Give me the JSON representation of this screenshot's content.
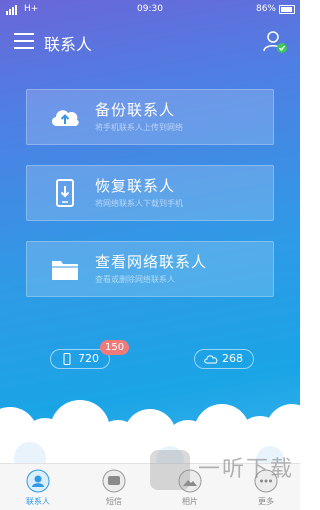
{
  "status_bar": {
    "network": "H+",
    "time": "09:30",
    "battery": "86%"
  },
  "header": {
    "title": "联系人",
    "menu_icon": "menu-icon",
    "user_icon": "user-check-icon"
  },
  "actions": [
    {
      "title": "备份联系人",
      "subtitle": "将手机联系人上传到网络",
      "icon": "cloud-upload-icon"
    },
    {
      "title": "恢复联系人",
      "subtitle": "将网络联系人下载到手机",
      "icon": "phone-download-icon"
    },
    {
      "title": "查看网络联系人",
      "subtitle": "查看或删除网络联系人",
      "icon": "folder-icon"
    }
  ],
  "counts": {
    "local": "720",
    "local_badge": "150",
    "cloud": "268"
  },
  "nav": [
    {
      "label": "联系人",
      "icon": "contact-icon",
      "active": true
    },
    {
      "label": "短信",
      "icon": "message-icon",
      "active": false
    },
    {
      "label": "相片",
      "icon": "photo-icon",
      "active": false
    },
    {
      "label": "更多",
      "icon": "more-icon",
      "active": false
    }
  ],
  "watermark": {
    "text": "一听下载"
  },
  "colors": {
    "accent": "#2f9ae6",
    "badge": "#f07a7a"
  }
}
